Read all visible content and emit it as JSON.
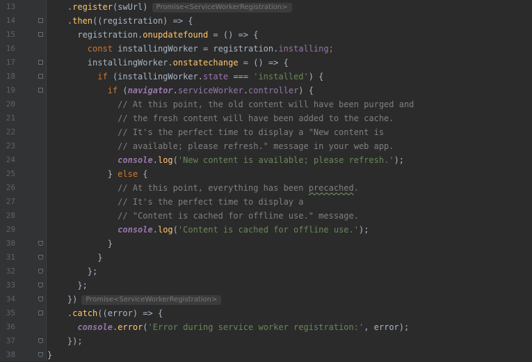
{
  "editor": {
    "hint_type": "Promise<ServiceWorkerRegistration>",
    "lines": [
      {
        "n": "13",
        "parts": [
          [
            "p",
            "    "
          ],
          [
            "p",
            "."
          ],
          [
            "fn",
            "register"
          ],
          [
            "p",
            "(swUrl)"
          ],
          [
            "hint",
            "Promise<ServiceWorkerRegistration>"
          ]
        ]
      },
      {
        "n": "14",
        "parts": [
          [
            "p",
            "    ."
          ],
          [
            "fn",
            "then"
          ],
          [
            "p",
            "((registration) => {"
          ]
        ]
      },
      {
        "n": "15",
        "parts": [
          [
            "p",
            "      registration."
          ],
          [
            "fn",
            "onupdatefound"
          ],
          [
            "p",
            " = () => {"
          ]
        ]
      },
      {
        "n": "16",
        "parts": [
          [
            "p",
            "        "
          ],
          [
            "kw",
            "const "
          ],
          [
            "p",
            "installingWorker = registration."
          ],
          [
            "prop",
            "installing"
          ],
          [
            "kw",
            ";"
          ]
        ]
      },
      {
        "n": "17",
        "parts": [
          [
            "p",
            "        installingWorker."
          ],
          [
            "fn",
            "onstatechange"
          ],
          [
            "p",
            " = () => {"
          ]
        ]
      },
      {
        "n": "18",
        "parts": [
          [
            "p",
            "          "
          ],
          [
            "kw",
            "if "
          ],
          [
            "p",
            "(installingWorker."
          ],
          [
            "prop",
            "state"
          ],
          [
            "p",
            " === "
          ],
          [
            "str",
            "'installed'"
          ],
          [
            "p",
            ") {"
          ]
        ]
      },
      {
        "n": "19",
        "parts": [
          [
            "p",
            "            "
          ],
          [
            "kw",
            "if "
          ],
          [
            "p",
            "("
          ],
          [
            "gl",
            "navigator"
          ],
          [
            "p",
            "."
          ],
          [
            "prop",
            "serviceWorker"
          ],
          [
            "p",
            "."
          ],
          [
            "prop",
            "controller"
          ],
          [
            "p",
            ") {"
          ]
        ]
      },
      {
        "n": "20",
        "parts": [
          [
            "p",
            "              "
          ],
          [
            "cm",
            "// At this point, the old content will have been purged and"
          ]
        ]
      },
      {
        "n": "21",
        "parts": [
          [
            "p",
            "              "
          ],
          [
            "cm",
            "// the fresh content will have been added to the cache."
          ]
        ]
      },
      {
        "n": "22",
        "parts": [
          [
            "p",
            "              "
          ],
          [
            "cm",
            "// It's the perfect time to display a \"New content is"
          ]
        ]
      },
      {
        "n": "23",
        "parts": [
          [
            "p",
            "              "
          ],
          [
            "cm",
            "// available; please refresh.\" message in your web app."
          ]
        ]
      },
      {
        "n": "24",
        "parts": [
          [
            "p",
            "              "
          ],
          [
            "con",
            "console"
          ],
          [
            "p",
            "."
          ],
          [
            "fn",
            "log"
          ],
          [
            "p",
            "("
          ],
          [
            "str",
            "'New content is available; please refresh.'"
          ],
          [
            "p",
            ");"
          ]
        ]
      },
      {
        "n": "25",
        "parts": [
          [
            "p",
            "            } "
          ],
          [
            "kw",
            "else "
          ],
          [
            "p",
            "{"
          ]
        ]
      },
      {
        "n": "26",
        "parts": [
          [
            "p",
            "              "
          ],
          [
            "cm",
            "// At this point, everything has been "
          ],
          [
            "squig",
            "precached"
          ],
          [
            "cm",
            "."
          ]
        ]
      },
      {
        "n": "27",
        "parts": [
          [
            "p",
            "              "
          ],
          [
            "cm",
            "// It's the perfect time to display a"
          ]
        ]
      },
      {
        "n": "28",
        "parts": [
          [
            "p",
            "              "
          ],
          [
            "cm",
            "// \"Content is cached for offline use.\" message."
          ]
        ]
      },
      {
        "n": "29",
        "parts": [
          [
            "p",
            "              "
          ],
          [
            "con",
            "console"
          ],
          [
            "p",
            "."
          ],
          [
            "fn",
            "log"
          ],
          [
            "p",
            "("
          ],
          [
            "str",
            "'Content is cached for offline use.'"
          ],
          [
            "p",
            ");"
          ]
        ]
      },
      {
        "n": "30",
        "parts": [
          [
            "p",
            "            }"
          ]
        ]
      },
      {
        "n": "31",
        "parts": [
          [
            "p",
            "          }"
          ]
        ]
      },
      {
        "n": "32",
        "parts": [
          [
            "p",
            "        };"
          ]
        ]
      },
      {
        "n": "33",
        "parts": [
          [
            "p",
            "      };"
          ]
        ]
      },
      {
        "n": "34",
        "parts": [
          [
            "p",
            "    })"
          ],
          [
            "hint",
            "Promise<ServiceWorkerRegistration>"
          ]
        ]
      },
      {
        "n": "35",
        "parts": [
          [
            "p",
            "    ."
          ],
          [
            "fn",
            "catch"
          ],
          [
            "p",
            "((error) => {"
          ]
        ]
      },
      {
        "n": "36",
        "parts": [
          [
            "p",
            "      "
          ],
          [
            "con",
            "console"
          ],
          [
            "p",
            "."
          ],
          [
            "fn",
            "error"
          ],
          [
            "p",
            "("
          ],
          [
            "str",
            "'Error during service worker registration:'"
          ],
          [
            "p",
            ", error);"
          ]
        ]
      },
      {
        "n": "37",
        "parts": [
          [
            "p",
            "    });"
          ]
        ]
      },
      {
        "n": "38",
        "parts": [
          [
            "p",
            "}"
          ]
        ]
      }
    ]
  },
  "colors": {
    "background": "#2b2b2b",
    "gutter": "#313335",
    "keyword": "#cc7832",
    "function": "#ffc66d",
    "property": "#9876aa",
    "string": "#6a8759",
    "comment": "#808080",
    "plain": "#a9b7c6"
  }
}
